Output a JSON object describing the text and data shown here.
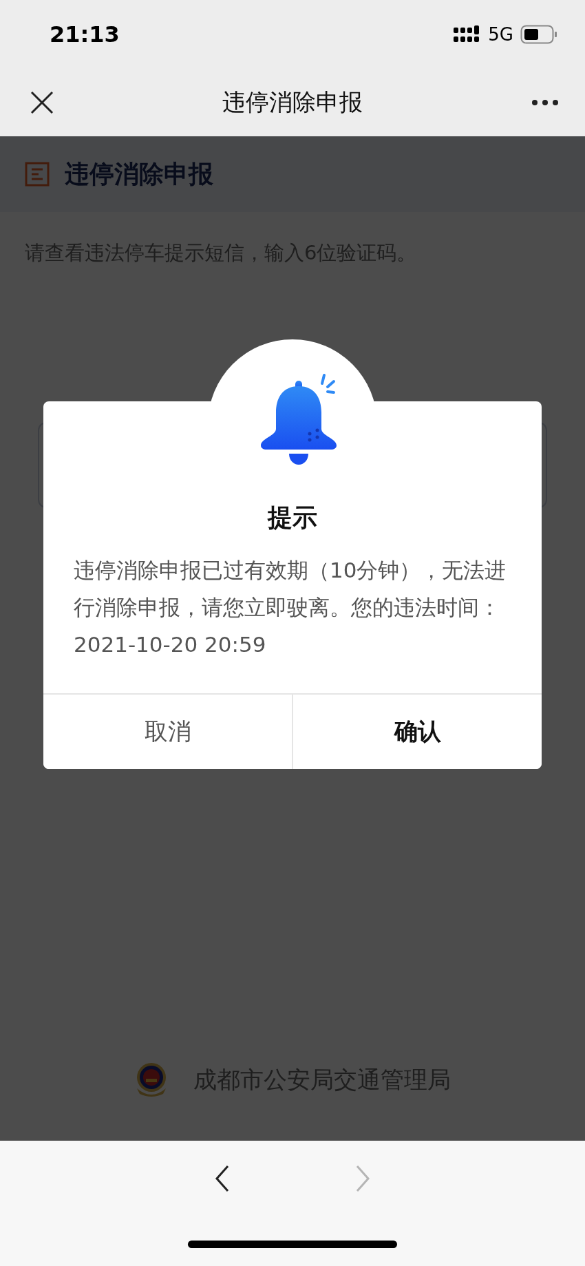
{
  "status_bar": {
    "time": "21:13",
    "network": "5G"
  },
  "nav_bar": {
    "title": "违停消除申报"
  },
  "page": {
    "header_title": "违停消除申报",
    "instruction": "请查看违法停车提示短信，输入6位验证码。",
    "footer": "成都市公安局交通管理局"
  },
  "dialog": {
    "title": "提示",
    "message": "违停消除申报已过有效期（10分钟），无法进行消除申报，请您立即驶离。您的违法时间：2021-10-20 20:59",
    "buttons": [
      {
        "label": "取消",
        "primary": false
      },
      {
        "label": "确认",
        "primary": true
      }
    ]
  },
  "browser_nav": [
    {
      "kind": "back",
      "disabled": false
    },
    {
      "kind": "forward",
      "disabled": true
    }
  ]
}
